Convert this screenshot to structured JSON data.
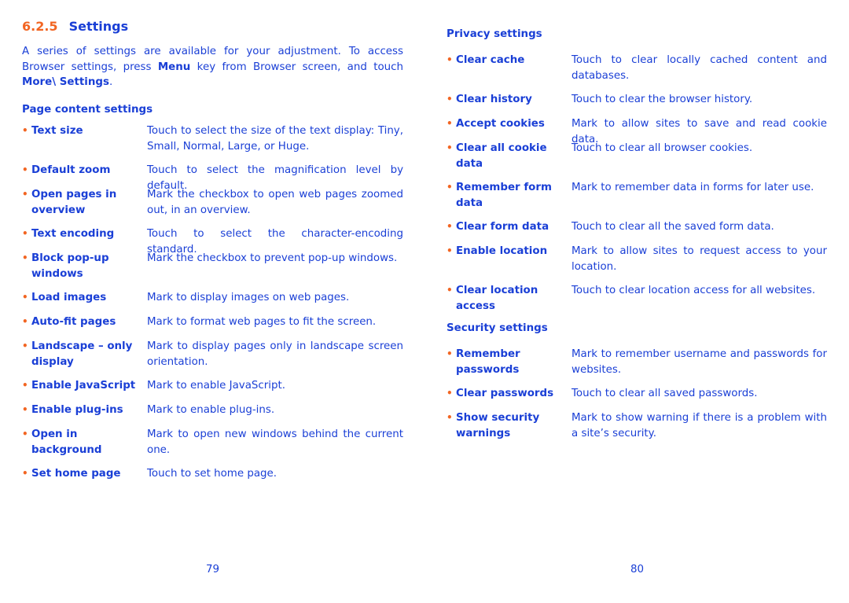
{
  "left_page": {
    "section_number": "6.2.5",
    "section_title": "Settings",
    "intro": {
      "text_1": "A series of settings are available for your adjustment. To access Browser settings, press ",
      "bold_1": "Menu",
      "text_2": " key from Browser screen, and touch ",
      "bold_2": "More\\ Settings",
      "text_3": "."
    },
    "page_content_settings": {
      "title": "Page content settings",
      "items": [
        {
          "label": "Text size",
          "desc": "Touch to select the size of the text display: Tiny, Small, Normal, Large, or Huge."
        },
        {
          "label": "Default zoom",
          "desc": "Touch to select the magnification level by default."
        },
        {
          "label": "Open pages in overview",
          "desc": "Mark the checkbox to open web pages zoomed out, in an overview."
        },
        {
          "label": "Text encoding",
          "desc": "Touch to select the character-encoding standard."
        },
        {
          "label": "Block pop-up windows",
          "desc": "Mark the checkbox to prevent pop-up windows."
        },
        {
          "label": "Load images",
          "desc": "Mark to display images on web pages."
        },
        {
          "label": "Auto-fit pages",
          "desc": "Mark to format web pages to fit the screen."
        },
        {
          "label": "Landscape – only display",
          "desc": "Mark to display pages only in landscape screen orientation."
        },
        {
          "label": "Enable JavaScript",
          "desc": "Mark to enable JavaScript."
        },
        {
          "label": "Enable plug-ins",
          "desc": "Mark to enable plug-ins."
        },
        {
          "label": "Open in background",
          "desc": "Mark to open new windows behind the current one."
        },
        {
          "label": "Set home page",
          "desc": "Touch to set home page."
        }
      ]
    },
    "page_number": "79"
  },
  "right_page": {
    "privacy_settings": {
      "title": "Privacy settings",
      "items": [
        {
          "label": "Clear cache",
          "desc": "Touch to clear locally cached content and databases."
        },
        {
          "label": "Clear history",
          "desc": "Touch to clear the browser history."
        },
        {
          "label": "Accept cookies",
          "desc": "Mark to allow sites to save and read cookie data."
        },
        {
          "label": "Clear all cookie data",
          "desc": "Touch to clear all browser cookies."
        },
        {
          "label": "Remember form data",
          "desc": "Mark to remember data in forms for later use."
        },
        {
          "label": "Clear form data",
          "desc": "Touch to clear all the saved form data."
        },
        {
          "label": "Enable location",
          "desc": "Mark to allow sites to request access to your location."
        },
        {
          "label": "Clear location access",
          "desc": "Touch to clear location access for all websites."
        }
      ]
    },
    "security_settings": {
      "title": "Security settings",
      "items": [
        {
          "label": "Remember passwords",
          "desc": "Mark to remember username and passwords for websites."
        },
        {
          "label": "Clear passwords",
          "desc": "Touch to clear all saved passwords."
        },
        {
          "label": "Show security warnings",
          "desc": "Mark to show warning if there is a problem with a site’s security."
        }
      ]
    },
    "page_number": "80"
  },
  "bullet_glyph": "•",
  "colors": {
    "text_blue": "#1a3fd6",
    "accent_orange": "#f26522"
  }
}
